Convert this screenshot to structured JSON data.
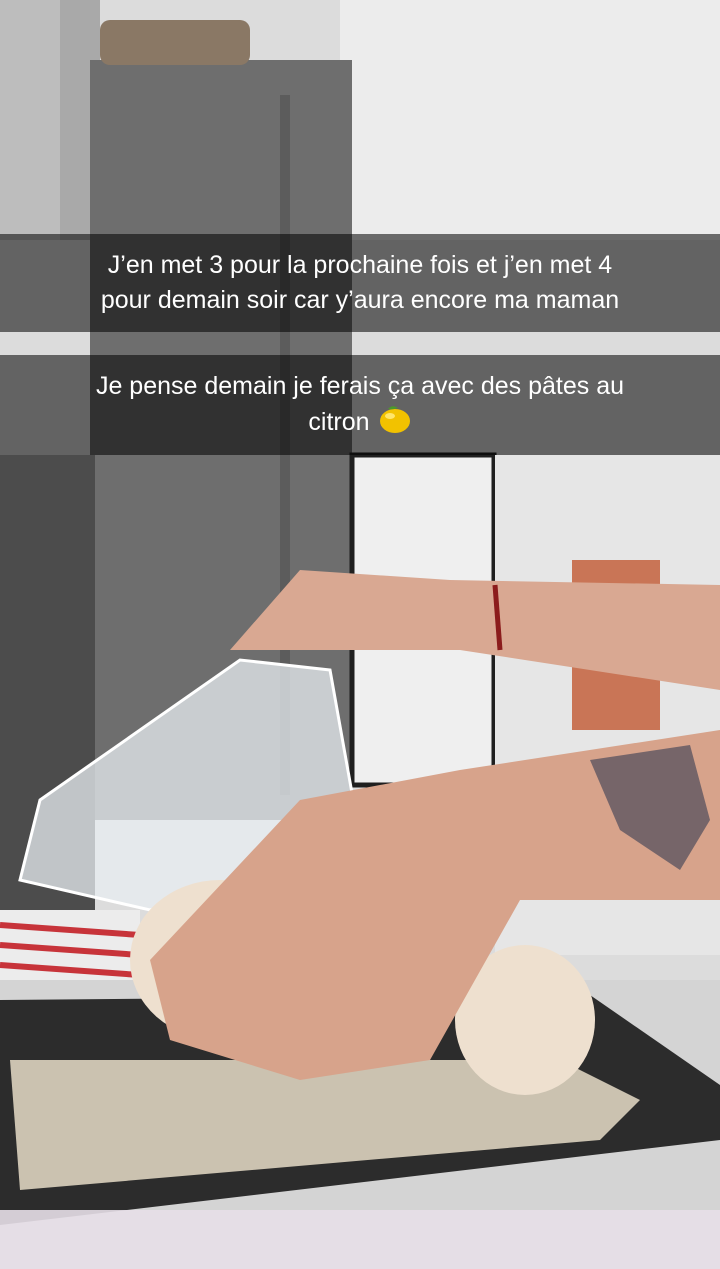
{
  "captions": [
    {
      "line1": "J’en met 3 pour la prochaine fois et j’en met 4",
      "line2": "pour demain soir car y’aura encore ma maman"
    },
    {
      "line1": "Je pense demain je ferais ça avec des pâtes au",
      "line2": "citron"
    }
  ],
  "emoji": {
    "name": "lemon-emoji",
    "icon": "lemon-icon",
    "color": "#f2c200"
  },
  "scene": {
    "description_icon": "photo-background",
    "colors": {
      "wall": "#e3e3e3",
      "fridge": "#6f6f6f",
      "tray": "#2c2c2c",
      "skin": "#d9a892",
      "crumbs": "#e8ddc8",
      "brick": "#c97556"
    }
  }
}
